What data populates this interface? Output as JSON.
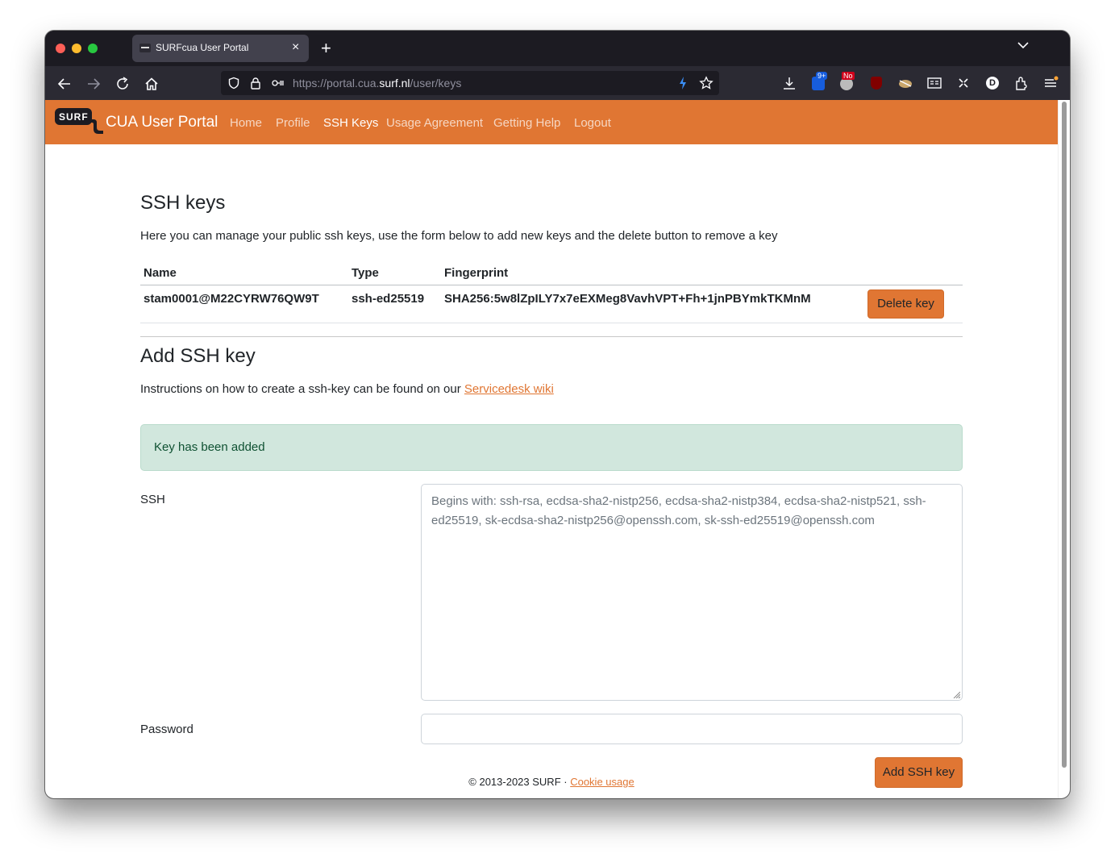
{
  "browser": {
    "tab_title": "SURFcua User Portal",
    "tab_close": "×",
    "new_tab": "+",
    "url_prefix": "https://portal.cua.",
    "url_host": "surf.nl",
    "url_path": "/user/keys",
    "icons": [
      "back-icon",
      "forward-icon",
      "reload-icon",
      "home-icon",
      "shield-icon",
      "lock-icon",
      "permissions-icon",
      "lightning-icon",
      "star-icon",
      "download-icon",
      "bitwarden-icon",
      "noscript-icon",
      "ublock-icon",
      "extension-icon",
      "reader-icon",
      "screenshot-icon",
      "account-icon",
      "extensions-icon",
      "menu-icon"
    ],
    "bitwarden_badge": "9+",
    "noscript_badge": "No",
    "avatar_letter": "D"
  },
  "site": {
    "logo_text": "SURF",
    "brand": "CUA User Portal",
    "nav": {
      "home": "Home",
      "profile": "Profile",
      "ssh_keys": "SSH Keys",
      "usage": "Usage Agreement",
      "help": "Getting Help",
      "logout": "Logout"
    },
    "accent_color": "#e07633"
  },
  "keys": {
    "title": "SSH keys",
    "description": "Here you can manage your public ssh keys, use the form below to add new keys and the delete button to remove a key",
    "columns": [
      "Name",
      "Type",
      "Fingerprint"
    ],
    "rows": [
      {
        "name": "stam0001@M22CYRW76QW9T",
        "type": "ssh-ed25519",
        "fingerprint": "SHA256:5w8lZpILY7x7eEXMeg8VavhVPT+Fh+1jnPBYmkTKMnM",
        "delete_label": "Delete key"
      }
    ]
  },
  "add": {
    "title": "Add SSH key",
    "instructions_prefix": "Instructions on how to create a ssh-key can be found on our ",
    "instructions_link": "Servicedesk wiki",
    "alert": "Key has been added",
    "ssh_label": "SSH",
    "ssh_placeholder": "Begins with: ssh-rsa, ecdsa-sha2-nistp256, ecdsa-sha2-nistp384, ecdsa-sha2-nistp521, ssh-ed25519, sk-ecdsa-sha2-nistp256@openssh.com, sk-ssh-ed25519@openssh.com",
    "ssh_value": "",
    "password_label": "Password",
    "password_value": "",
    "submit_label": "Add SSH key"
  },
  "footer": {
    "text": "© 2013-2023 SURF · ",
    "cookie_link": "Cookie usage"
  }
}
